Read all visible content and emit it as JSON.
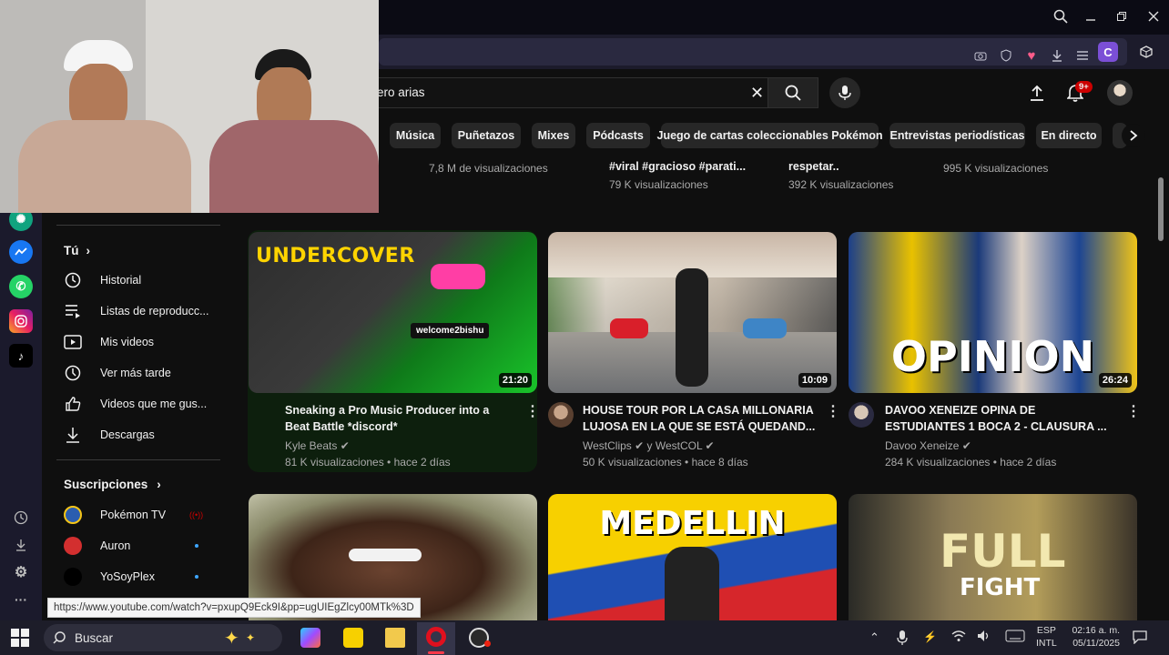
{
  "browser": {
    "search_query": "ero arias",
    "profile_letter": "C"
  },
  "header": {
    "notification_count": "9+"
  },
  "chips": [
    "Música",
    "Puñetazos",
    "Mixes",
    "Pódcasts",
    "Juego de cartas coleccionables Pokémon",
    "Entrevistas periodísticas",
    "En directo"
  ],
  "prev_row": [
    {
      "line1": "",
      "line2": "7,8 M de visualizaciones"
    },
    {
      "line1": "#viral #gracioso #parati...",
      "line2": "79 K visualizaciones"
    },
    {
      "line1": "respetar..",
      "line2": "392 K visualizaciones"
    },
    {
      "line1": "",
      "line2": "995 K visualizaciones"
    }
  ],
  "sidebar": {
    "you_label": "Tú",
    "items": [
      {
        "label": "Historial",
        "icon": "history-icon"
      },
      {
        "label": "Listas de reproducc...",
        "icon": "playlist-icon"
      },
      {
        "label": "Mis videos",
        "icon": "my-videos-icon"
      },
      {
        "label": "Ver más tarde",
        "icon": "watch-later-icon"
      },
      {
        "label": "Videos que me gus...",
        "icon": "liked-icon"
      },
      {
        "label": "Descargas",
        "icon": "download-icon"
      }
    ],
    "subs_label": "Suscripciones",
    "subs": [
      {
        "label": "Pokémon TV",
        "color": "#2a5db0"
      },
      {
        "label": "Auron",
        "color": "#d32f2f"
      },
      {
        "label": "YoSoyPlex",
        "color": "#111111"
      }
    ]
  },
  "videos": [
    {
      "thumb_text": "UNDERCOVER",
      "badge_text": "welcome2bishu",
      "duration": "21:20",
      "title1": "Sneaking a Pro Music Producer into a",
      "title2": "Beat Battle *discord*",
      "channel": "Kyle Beats",
      "stats": "81 K visualizaciones • hace 2 días"
    },
    {
      "thumb_text": "",
      "duration": "10:09",
      "title1": "HOUSE TOUR POR LA CASA MILLONARIA",
      "title2": "LUJOSA EN LA QUE SE ESTÁ QUEDAND...",
      "channel": "WestClips ✔ y WestCOL",
      "stats": "50 K visualizaciones • hace 8 días"
    },
    {
      "thumb_text": "OPINION",
      "duration": "26:24",
      "title1": "DAVOO XENEIZE OPINA DE",
      "title2": "ESTUDIANTES 1 BOCA 2 - CLAUSURA ...",
      "channel": "Davoo Xeneize",
      "stats": "284 K visualizaciones • hace 2 días"
    }
  ],
  "row2": [
    {
      "thumb_text": ""
    },
    {
      "thumb_text": "MEDELLIN"
    },
    {
      "thumb_text1": "FULL",
      "thumb_text2": "FIGHT"
    }
  ],
  "status_url": "https://www.youtube.com/watch?v=pxupQ9Eck9I&pp=ugUIEgZlcy00MTk%3D",
  "taskbar": {
    "search_label": "Buscar",
    "lang1": "ESP",
    "lang2": "INTL",
    "time": "02:16 a. m.",
    "date": "05/11/2025"
  }
}
